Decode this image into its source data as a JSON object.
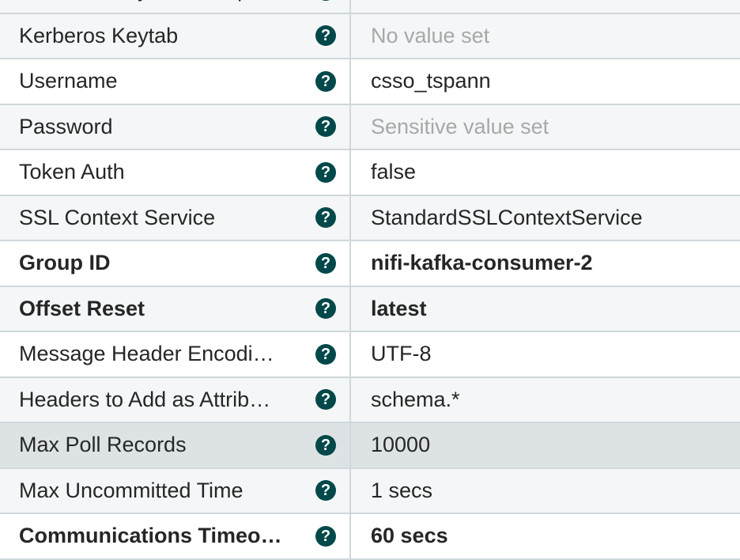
{
  "properties": [
    {
      "name": "Kerberos Keytab Principal",
      "value": ""
    },
    {
      "name": "Kerberos Keytab",
      "value": "No value set",
      "unset": true
    },
    {
      "name": "Username",
      "value": "csso_tspann"
    },
    {
      "name": "Password",
      "value": "Sensitive value set",
      "unset": true
    },
    {
      "name": "Token Auth",
      "value": "false"
    },
    {
      "name": "SSL Context Service",
      "value": "StandardSSLContextService"
    },
    {
      "name": "Group ID",
      "value": "nifi-kafka-consumer-2",
      "required": true
    },
    {
      "name": "Offset Reset",
      "value": "latest",
      "required": true
    },
    {
      "name": "Message Header Encodi…",
      "value": "UTF-8"
    },
    {
      "name": "Headers to Add as Attrib…",
      "value": "schema.*"
    },
    {
      "name": "Max Poll Records",
      "value": "10000",
      "highlighted": true
    },
    {
      "name": "Max Uncommitted Time",
      "value": "1 secs"
    },
    {
      "name": "Communications Timeo…",
      "value": "60 secs",
      "required": true
    }
  ],
  "help_icon": {
    "name": "question-circle-icon",
    "glyph": "?",
    "color": "#004849"
  }
}
